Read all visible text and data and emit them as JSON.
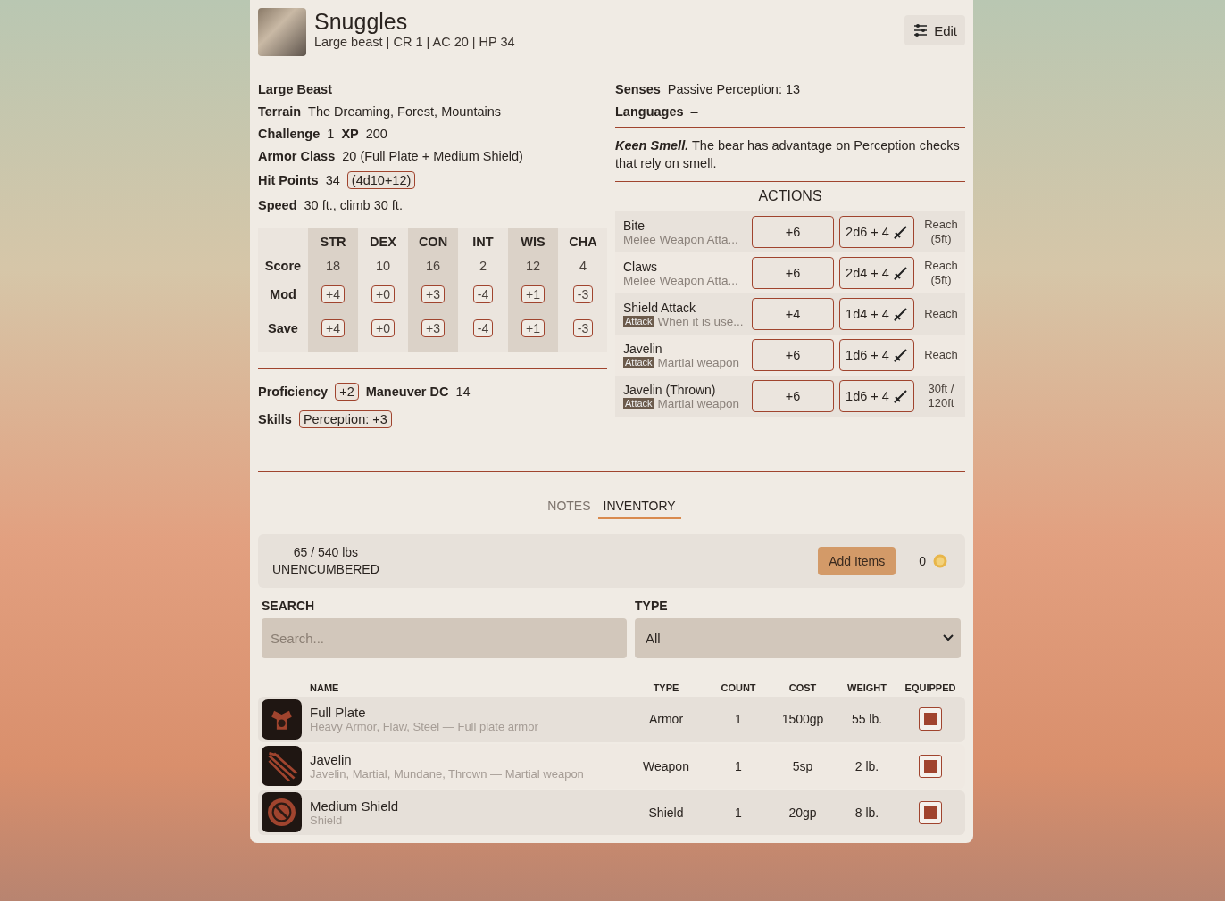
{
  "header": {
    "name": "Snuggles",
    "subtitle": "Large beast | CR 1 | AC 20 | HP 34",
    "edit_label": "Edit"
  },
  "details": {
    "type_line": "Large Beast",
    "terrain_label": "Terrain",
    "terrain": "The Dreaming, Forest, Mountains",
    "challenge_label": "Challenge",
    "challenge": "1",
    "xp_label": "XP",
    "xp": "200",
    "ac_label": "Armor Class",
    "ac": "20 (Full Plate + Medium Shield)",
    "hp_label": "Hit Points",
    "hp": "34",
    "hp_dice": "(4d10+12)",
    "speed_label": "Speed",
    "speed": "30 ft., climb 30 ft."
  },
  "abilities": {
    "row_labels": [
      "Score",
      "Mod",
      "Save"
    ],
    "columns": [
      {
        "name": "STR",
        "score": "18",
        "mod": "+4",
        "save": "+4"
      },
      {
        "name": "DEX",
        "score": "10",
        "mod": "+0",
        "save": "+0"
      },
      {
        "name": "CON",
        "score": "16",
        "mod": "+3",
        "save": "+3"
      },
      {
        "name": "INT",
        "score": "2",
        "mod": "-4",
        "save": "-4"
      },
      {
        "name": "WIS",
        "score": "12",
        "mod": "+1",
        "save": "+1"
      },
      {
        "name": "CHA",
        "score": "4",
        "mod": "-3",
        "save": "-3"
      }
    ]
  },
  "proficiency": {
    "label": "Proficiency",
    "value": "+2",
    "dc_label": "Maneuver DC",
    "dc": "14",
    "skills_label": "Skills",
    "skills": [
      "Perception: +3"
    ]
  },
  "senses": {
    "senses_label": "Senses",
    "senses": "Passive Perception: 13",
    "languages_label": "Languages",
    "languages": "–"
  },
  "trait": "**Keen Smell.** The bear has advantage on Perception checks that rely on smell.",
  "actions": {
    "title": "ACTIONS",
    "rows": [
      {
        "name": "Bite",
        "tag": null,
        "description": "Melee Weapon Atta...",
        "hit": "+6",
        "damage": "2d6 + 4",
        "range": "Reach (5ft)"
      },
      {
        "name": "Claws",
        "tag": null,
        "description": "Melee Weapon Atta...",
        "hit": "+6",
        "damage": "2d4 + 4",
        "range": "Reach (5ft)"
      },
      {
        "name": "Shield Attack",
        "tag": "Attack",
        "description": "When it is use...",
        "hit": "+4",
        "damage": "1d4 + 4",
        "range": "Reach"
      },
      {
        "name": "Javelin",
        "tag": "Attack",
        "description": "Martial weapon",
        "hit": "+6",
        "damage": "1d6 + 4",
        "range": "Reach"
      },
      {
        "name": "Javelin (Thrown)",
        "tag": "Attack",
        "description": "Martial weapon",
        "hit": "+6",
        "damage": "1d6 + 4",
        "range": "30ft / 120ft"
      }
    ]
  },
  "tabs": [
    {
      "label": "NOTES",
      "selected": false
    },
    {
      "label": "INVENTORY",
      "selected": true
    }
  ],
  "inventory": {
    "weight": "65 / 540 lbs",
    "encumbrance": "UNENCUMBERED",
    "add_label": "Add Items",
    "coins": "0",
    "search_label": "SEARCH",
    "search_placeholder": "Search...",
    "type_label": "TYPE",
    "type_value": "All",
    "columns": [
      "NAME",
      "TYPE",
      "COUNT",
      "COST",
      "WEIGHT",
      "EQUIPPED"
    ],
    "items": [
      {
        "kind": "armor",
        "name": "Full Plate",
        "description": "Heavy Armor, Flaw, Steel — Full plate armor",
        "type": "Armor",
        "count": "1",
        "cost": "1500gp",
        "weight": "55 lb.",
        "equipped": true
      },
      {
        "kind": "weapon",
        "name": "Javelin",
        "description": "Javelin, Martial, Mundane, Thrown — Martial weapon",
        "type": "Weapon",
        "count": "1",
        "cost": "5sp",
        "weight": "2 lb.",
        "equipped": true
      },
      {
        "kind": "shield",
        "name": "Medium Shield",
        "description": "Shield",
        "type": "Shield",
        "count": "1",
        "cost": "20gp",
        "weight": "8 lb.",
        "equipped": true
      }
    ]
  }
}
